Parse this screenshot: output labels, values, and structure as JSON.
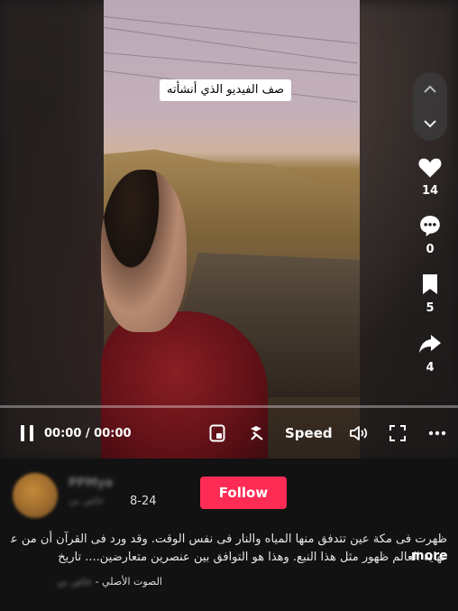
{
  "player": {
    "caption": "صف الفيديو الذي أنشأته",
    "likes": "14",
    "comments": "0",
    "saves": "5",
    "shares": "4",
    "time": "00:00 / 00:00",
    "speed_label": "Speed",
    "progress": 0
  },
  "author": {
    "username": "PPMya",
    "subtitle": "خاص بي",
    "date": "8-24",
    "follow_label": "Follow"
  },
  "description": {
    "line1": "ظهرت فى مكة عين تتدفق منها المياه والنار فى نفس الوقت. وقد ورد فى القرآن أن من علامات",
    "line2": "نهاية العالم ظهور مثل هذا النبع. وهذا هو التوافق بين عنصرين متعارضين.... تاريخ...",
    "more_label": "more"
  },
  "sound": {
    "label": "الصوت الأصلي -",
    "owner": "خاص بي"
  },
  "colors": {
    "accent": "#fe2c55",
    "background": "#121212"
  }
}
